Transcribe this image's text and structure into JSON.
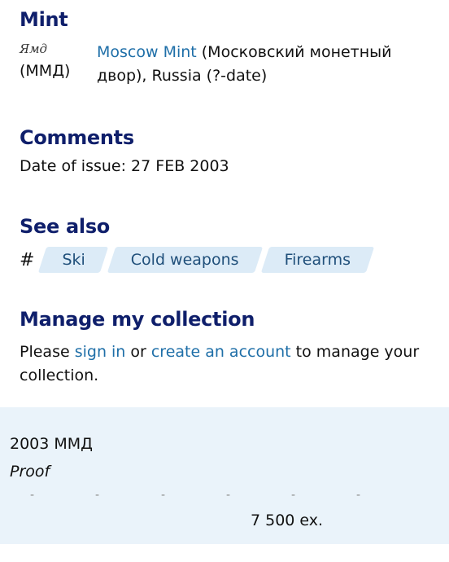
{
  "mint": {
    "heading": "Mint",
    "mark_glyph": "Ямд",
    "mark_code": "(ММД)",
    "link_text": "Moscow Mint",
    "description": " (Московский монетный двор), Russia (?-date)"
  },
  "comments": {
    "heading": "Comments",
    "text": "Date of issue: 27 FEB 2003"
  },
  "see_also": {
    "heading": "See also",
    "hash": "#",
    "tags": [
      "Ski",
      "Cold weapons",
      "Firearms"
    ]
  },
  "manage": {
    "heading": "Manage my collection",
    "pre": "Please ",
    "sign_in": "sign in",
    "mid": " or ",
    "create_account": "create an account",
    "post": " to manage your collection."
  },
  "issue": {
    "year_mint": "2003 ММД",
    "variety": "Proof",
    "dash": "-",
    "mintage": "7 500 ex."
  }
}
